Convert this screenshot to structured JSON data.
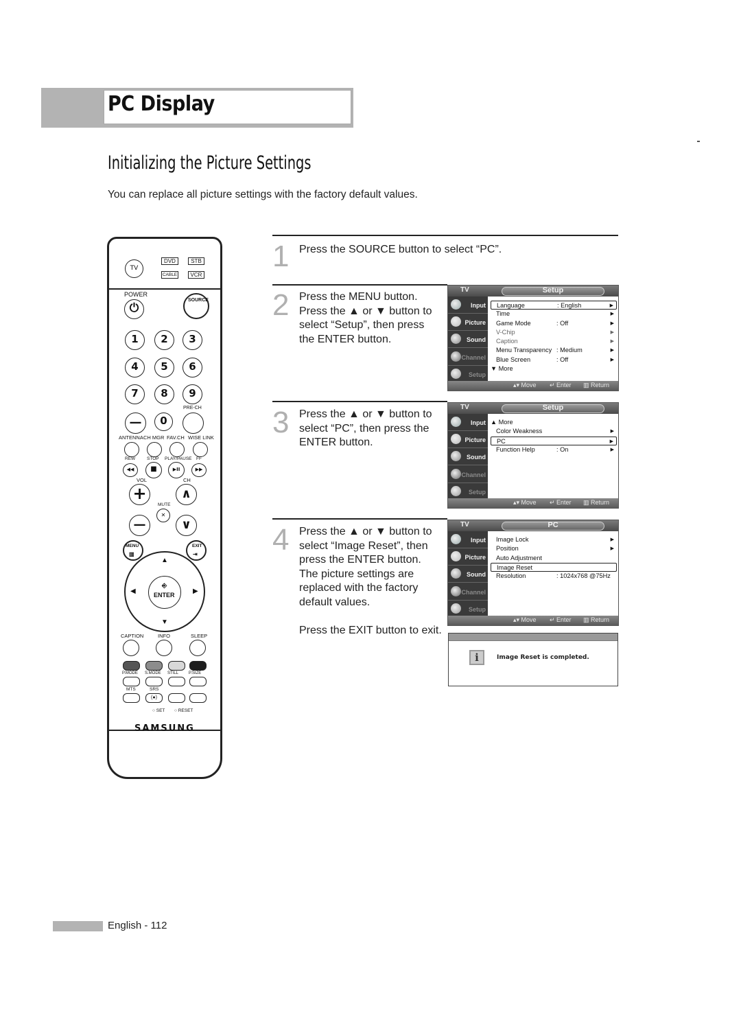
{
  "header": {
    "title": "PC Display"
  },
  "section": {
    "title": "Initializing the Picture Settings",
    "intro": "You can replace all picture settings with the factory default values."
  },
  "steps": [
    {
      "num": "1",
      "lines": [
        "Press the SOURCE button to select “PC”."
      ]
    },
    {
      "num": "2",
      "lines": [
        "Press the MENU button.",
        "Press the ▲ or ▼ button to",
        "select “Setup”, then press",
        "the ENTER button."
      ]
    },
    {
      "num": "3",
      "lines": [
        "Press the ▲ or ▼ button to",
        "select “PC”, then press the",
        "ENTER button."
      ]
    },
    {
      "num": "4",
      "lines": [
        "Press the ▲ or ▼ button to",
        "select “Image Reset”, then",
        "press the ENTER button.",
        "The picture settings are",
        "replaced with the factory",
        "default values.",
        "",
        "Press the EXIT button to exit."
      ]
    }
  ],
  "osd_common": {
    "tv_label": "TV",
    "side": [
      {
        "label": "Input",
        "icon": "input-icon",
        "dim": false
      },
      {
        "label": "Picture",
        "icon": "picture-icon",
        "dim": false
      },
      {
        "label": "Sound",
        "icon": "sound-icon",
        "dim": false
      },
      {
        "label": "Channel",
        "icon": "channel-icon",
        "dim": true
      },
      {
        "label": "Setup",
        "icon": "setup-icon",
        "dim": true
      }
    ],
    "footer": {
      "move": "▴▾ Move",
      "enter": "↵ Enter",
      "return": "▥ Return"
    }
  },
  "osd_screens": [
    {
      "title": "Setup",
      "rows": [
        {
          "label": "Language",
          "value": ": English",
          "arrow": true,
          "selected": true,
          "dim": false
        },
        {
          "label": "Time",
          "value": "",
          "arrow": true,
          "selected": false,
          "dim": false
        },
        {
          "label": "Game Mode",
          "value": ": Off",
          "arrow": true,
          "selected": false,
          "dim": false
        },
        {
          "label": "V-Chip",
          "value": "",
          "arrow": true,
          "selected": false,
          "dim": true
        },
        {
          "label": "Caption",
          "value": "",
          "arrow": true,
          "selected": false,
          "dim": true
        },
        {
          "label": "Menu Transparency",
          "value": ": Medium",
          "arrow": true,
          "selected": false,
          "dim": false
        },
        {
          "label": "Blue Screen",
          "value": ": Off",
          "arrow": true,
          "selected": false,
          "dim": false
        },
        {
          "label": "▼ More",
          "value": "",
          "arrow": false,
          "selected": false,
          "dim": false,
          "more": true
        }
      ]
    },
    {
      "title": "Setup",
      "rows": [
        {
          "label": "▲ More",
          "value": "",
          "arrow": false,
          "selected": false,
          "dim": false,
          "more": true
        },
        {
          "label": "Color Weakness",
          "value": "",
          "arrow": true,
          "selected": false,
          "dim": false
        },
        {
          "label": "PC",
          "value": "",
          "arrow": true,
          "selected": true,
          "dim": false
        },
        {
          "label": "Function Help",
          "value": ": On",
          "arrow": true,
          "selected": false,
          "dim": false
        }
      ]
    },
    {
      "title": "PC",
      "rows": [
        {
          "label": "Image Lock",
          "value": "",
          "arrow": true,
          "selected": false,
          "dim": false
        },
        {
          "label": "Position",
          "value": "",
          "arrow": true,
          "selected": false,
          "dim": false
        },
        {
          "label": "Auto Adjustment",
          "value": "",
          "arrow": false,
          "selected": false,
          "dim": false
        },
        {
          "label": "Image Reset",
          "value": "",
          "arrow": false,
          "selected": true,
          "dim": false
        },
        {
          "label": "Resolution",
          "value": ": 1024x768 @75Hz",
          "arrow": false,
          "selected": false,
          "dim": false
        }
      ]
    }
  ],
  "message": {
    "icon": "info-icon",
    "glyph": "i",
    "text": "Image Reset is completed."
  },
  "remote": {
    "tv": "TV",
    "modes": [
      "DVD",
      "STB",
      "CABLE",
      "VCR"
    ],
    "power": "POWER",
    "source": "SOURCE",
    "digits": [
      "1",
      "2",
      "3",
      "4",
      "5",
      "6",
      "7",
      "8",
      "9"
    ],
    "dash": "—",
    "zero": "0",
    "pre_ch": "PRE-CH",
    "row_labels": [
      "ANTENNA",
      "CH MGR",
      "FAV.CH",
      "WISE LINK"
    ],
    "transport_labels": [
      "REW",
      "STOP",
      "PLAY/PAUSE",
      "FF"
    ],
    "transport_glyphs": [
      "◀◀",
      "■",
      "▶II",
      "▶▶"
    ],
    "vol": "VOL",
    "ch": "CH",
    "mute": "MUTE",
    "plus": "+",
    "minus": "—",
    "up": "∧",
    "down": "∨",
    "mute_glyph": "🔇",
    "menu": "MENU",
    "exit": "EXIT",
    "enter": "ENTER",
    "func_labels": [
      "CAPTION",
      "INFO",
      "SLEEP"
    ],
    "color_labels": [
      "P.MODE",
      "S.MODE",
      "STILL",
      "P.SIZE"
    ],
    "color_fills": [
      "#555555",
      "#8c8c8c",
      "#d8d8d8",
      "#1e1e1e"
    ],
    "mts": "MTS",
    "srs": "SRS",
    "srs_glyph": "(●)",
    "set": "SET",
    "reset": "RESET",
    "brand": "SAMSUNG"
  },
  "footer": {
    "page": "English - 112"
  }
}
